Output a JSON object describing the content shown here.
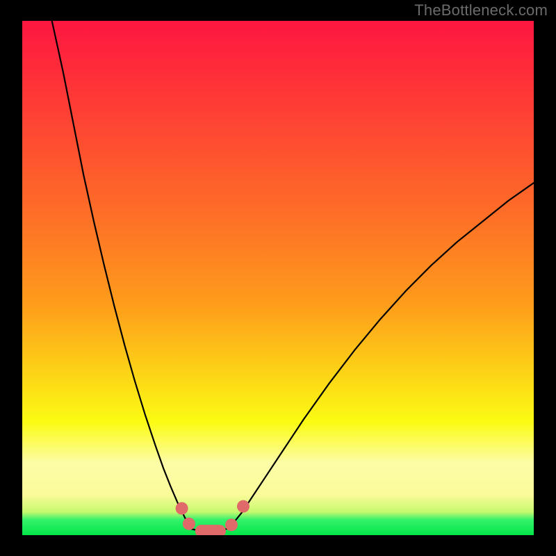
{
  "watermark": "TheBottleneck.com",
  "palette": {
    "black": "#000000",
    "red_top": "#fe1640",
    "orange": "#fe9c1b",
    "yellow": "#fbfb13",
    "pale_yellow": "#fcfda7",
    "green_band": "#34f26b",
    "green_bottom": "#03e547",
    "curve": "#000000",
    "marker_fill": "#e06969",
    "marker_stroke": "#d24f4f"
  },
  "chart_data": {
    "type": "line",
    "title": "",
    "xlabel": "",
    "ylabel": "",
    "xlim": [
      0,
      100
    ],
    "ylim": [
      0,
      100
    ],
    "note": "No axis ticks or numeric labels rendered; values below are estimated from pixel geometry of the curves and markers.",
    "series": [
      {
        "name": "left-curve",
        "x": [
          5.8,
          8,
          10,
          12,
          14,
          16,
          18,
          20,
          22,
          24,
          26,
          27.6,
          29,
          30.5,
          32,
          33
        ],
        "y": [
          100,
          90,
          80,
          70,
          61,
          52.5,
          44.5,
          37,
          30,
          23.5,
          17.5,
          13,
          9.5,
          6,
          3,
          1.2
        ]
      },
      {
        "name": "valley-floor",
        "x": [
          33,
          35,
          37,
          39,
          40.5
        ],
        "y": [
          1.2,
          0.8,
          0.8,
          0.9,
          1.4
        ]
      },
      {
        "name": "right-curve",
        "x": [
          40.5,
          43,
          46,
          50,
          55,
          60,
          65,
          70,
          75,
          80,
          85,
          90,
          95,
          100
        ],
        "y": [
          1.4,
          4.5,
          9,
          15,
          22.5,
          29.5,
          36,
          42,
          47.5,
          52.5,
          57,
          61,
          65,
          68.5
        ]
      }
    ],
    "markers": [
      {
        "shape": "round",
        "x": 31.2,
        "y": 5.2
      },
      {
        "shape": "round",
        "x": 32.6,
        "y": 2.2
      },
      {
        "shape": "pill",
        "x": 36.8,
        "y": 0.8,
        "len": 6.0
      },
      {
        "shape": "round",
        "x": 40.9,
        "y": 2.0
      },
      {
        "shape": "round",
        "x": 43.2,
        "y": 5.6
      }
    ],
    "zone_bands": [
      {
        "name": "green-zone",
        "y_from": 0,
        "y_to": 3.5
      },
      {
        "name": "pale-yellow-zone",
        "y_from": 3.5,
        "y_to": 14
      },
      {
        "name": "yellow-zone",
        "y_from": 14,
        "y_to": 45
      },
      {
        "name": "orange-zone",
        "y_from": 45,
        "y_to": 75
      },
      {
        "name": "red-zone",
        "y_from": 75,
        "y_to": 100
      }
    ]
  }
}
